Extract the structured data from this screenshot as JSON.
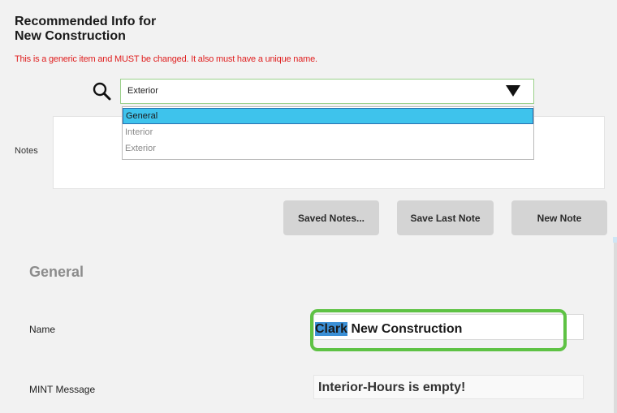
{
  "header": {
    "title": "Recommended Info for\nNew Construction",
    "warning": "This is a generic item and MUST be changed. It also must have a unique name."
  },
  "search": {
    "icon": "search-icon",
    "selected_value": "Exterior",
    "options": [
      "General",
      "Interior",
      "Exterior"
    ],
    "highlighted_option": "General"
  },
  "notes": {
    "label": "Notes",
    "value": ""
  },
  "buttons": {
    "saved_notes": "Saved Notes...",
    "save_last_note": "Save Last Note",
    "new_note": "New Note"
  },
  "general": {
    "section_title": "General",
    "name_label": "Name",
    "name_selected_part": "Clark",
    "name_rest": " New Construction",
    "mint_label": "MINT Message",
    "mint_value": "Interior-Hours is empty!"
  },
  "colors": {
    "warning": "#e02020",
    "highlight_border": "#5ec244",
    "selection": "#3ec3ec"
  }
}
